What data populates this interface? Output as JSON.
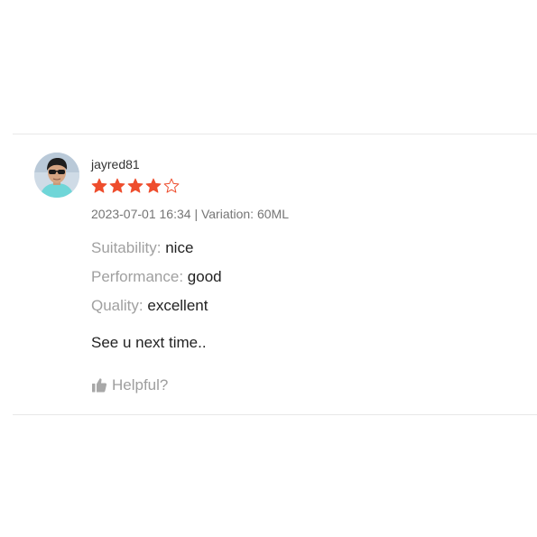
{
  "review": {
    "username": "jayred81",
    "rating": {
      "value": 4,
      "max": 5
    },
    "timestamp": "2023-07-01 16:34",
    "separator": "|",
    "variation_label": "Variation:",
    "variation_value": "60ML",
    "attributes": [
      {
        "label": "Suitability:",
        "value": "nice"
      },
      {
        "label": "Performance:",
        "value": "good"
      },
      {
        "label": "Quality:",
        "value": "excellent"
      }
    ],
    "comment": "See u next time..",
    "helpful_label": "Helpful?"
  },
  "icons": {
    "avatar": "user-avatar-photo",
    "star_filled": "star-filled-icon",
    "star_empty": "star-outline-icon",
    "helpful": "thumbs-up-icon"
  },
  "colors": {
    "star": "#ee4d2d",
    "muted_label": "#a0a0a0",
    "meta_text": "#757575",
    "divider": "#e8e8e8"
  }
}
